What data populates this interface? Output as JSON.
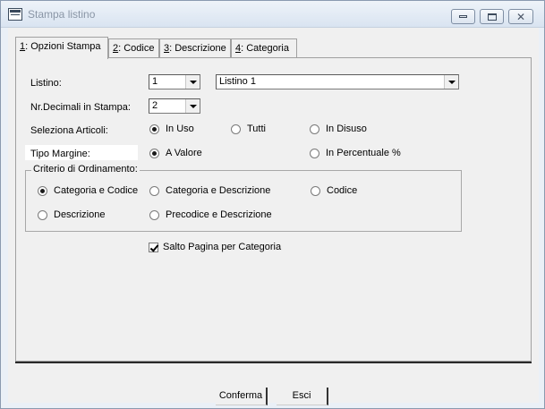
{
  "window": {
    "title": "Stampa listino",
    "controls": {
      "minimize": "minimize-icon",
      "maximize": "maximize-icon",
      "close": "close-icon"
    }
  },
  "tabs": [
    {
      "key": "1",
      "label": ": Opzioni Stampa",
      "active": true
    },
    {
      "key": "2",
      "label": ": Codice",
      "active": false
    },
    {
      "key": "3",
      "label": ": Descrizione",
      "active": false
    },
    {
      "key": "4",
      "label": ": Categoria",
      "active": false
    }
  ],
  "form": {
    "listino_label": "Listino:",
    "listino_code": "1",
    "listino_name": "Listino 1",
    "decimali_label": "Nr.Decimali in Stampa:",
    "decimali_value": "2",
    "seleziona_label": "Seleziona Articoli:",
    "seleziona_options": [
      "In Uso",
      "Tutti",
      "In Disuso"
    ],
    "seleziona_selected": "In Uso",
    "margine_label": "Tipo Margine:",
    "margine_options": [
      "A Valore",
      "In Percentuale %"
    ],
    "margine_selected": "A Valore"
  },
  "ordinamento": {
    "title": "Criterio di Ordinamento:",
    "options": [
      "Categoria e Codice",
      "Categoria e Descrizione",
      "Codice",
      "Descrizione",
      "Precodice e Descrizione"
    ],
    "selected": "Categoria e Codice"
  },
  "salto_pagina": {
    "label": "Salto Pagina per Categoria",
    "checked": true
  },
  "buttons": {
    "conferma": "Conferma",
    "esci": "Esci"
  }
}
